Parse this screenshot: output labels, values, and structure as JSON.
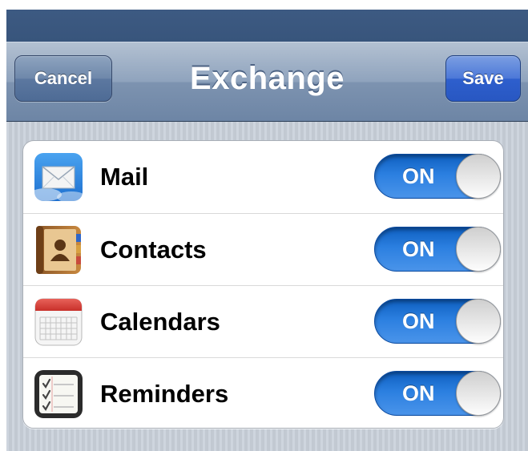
{
  "nav": {
    "title": "Exchange",
    "cancel_label": "Cancel",
    "save_label": "Save"
  },
  "accounts": [
    {
      "label": "Mail",
      "icon": "mail-icon",
      "toggle": "ON",
      "enabled": true
    },
    {
      "label": "Contacts",
      "icon": "contacts-icon",
      "toggle": "ON",
      "enabled": true
    },
    {
      "label": "Calendars",
      "icon": "calendar-icon",
      "toggle": "ON",
      "enabled": true
    },
    {
      "label": "Reminders",
      "icon": "reminders-icon",
      "toggle": "ON",
      "enabled": true
    }
  ],
  "colors": {
    "toggle_on": "#2b7fe0",
    "save_button": "#2e5fcd",
    "nav_bar": "#7d93b0",
    "status_bar": "#3d5a82"
  }
}
